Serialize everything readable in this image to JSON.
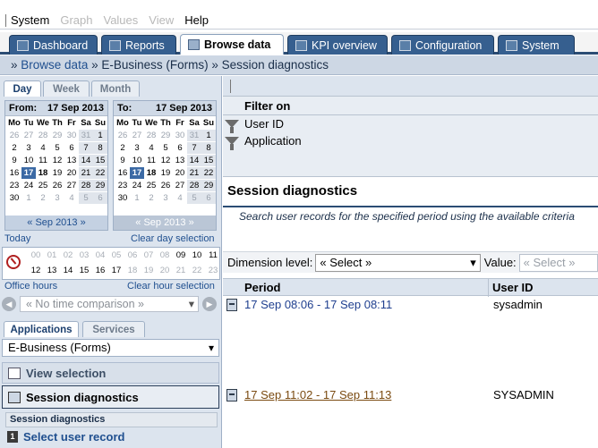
{
  "menu": {
    "items": [
      {
        "label": "System",
        "enabled": true
      },
      {
        "label": "Graph",
        "enabled": false
      },
      {
        "label": "Values",
        "enabled": false
      },
      {
        "label": "View",
        "enabled": false
      },
      {
        "label": "Help",
        "enabled": true
      }
    ]
  },
  "tabs": [
    {
      "label": "Dashboard",
      "icon": "dashboard-icon",
      "active": false
    },
    {
      "label": "Reports",
      "icon": "reports-icon",
      "active": false
    },
    {
      "label": "Browse data",
      "icon": "cube-icon",
      "active": true
    },
    {
      "label": "KPI overview",
      "icon": "gauge-icon",
      "active": false
    },
    {
      "label": "Configuration",
      "icon": "gear-icon",
      "active": false
    },
    {
      "label": "System",
      "icon": "monitor-icon",
      "active": false
    }
  ],
  "breadcrumb": {
    "prefix": "»",
    "link": "Browse data",
    "rest": "» E-Business (Forms) » Session diagnostics"
  },
  "period_tabs": [
    "Day",
    "Week",
    "Month"
  ],
  "calendar_from": {
    "label": "From:",
    "date": "17 Sep 2013",
    "month": "« Sep 2013 »"
  },
  "calendar_to": {
    "label": "To:",
    "date": "17 Sep 2013",
    "month": "« Sep 2013 »"
  },
  "dow": [
    "Mo",
    "Tu",
    "We",
    "Th",
    "Fr",
    "Sa",
    "Su"
  ],
  "days": [
    "26",
    "27",
    "28",
    "29",
    "30",
    "31",
    "1",
    "2",
    "3",
    "4",
    "5",
    "6",
    "7",
    "8",
    "9",
    "10",
    "11",
    "12",
    "13",
    "14",
    "15",
    "16",
    "17",
    "18",
    "19",
    "20",
    "21",
    "22",
    "23",
    "24",
    "25",
    "26",
    "27",
    "28",
    "29",
    "30",
    "1",
    "2",
    "3",
    "4",
    "5",
    "6"
  ],
  "today_link": "Today",
  "clear_day": "Clear day selection",
  "hours_row1": [
    "00",
    "01",
    "02",
    "03",
    "04",
    "05",
    "06",
    "07",
    "08",
    "09",
    "10",
    "11"
  ],
  "hours_row2": [
    "12",
    "13",
    "14",
    "15",
    "16",
    "17",
    "18",
    "19",
    "20",
    "21",
    "22",
    "23"
  ],
  "office_hours": "Office hours",
  "clear_hour": "Clear hour selection",
  "time_comparison": "« No time comparison »",
  "left_tabs": [
    "Applications",
    "Services"
  ],
  "application_select": "E-Business (Forms)",
  "view_selection": "View selection",
  "session_diagnostics": "Session diagnostics",
  "section_label": "Session diagnostics",
  "select_user_record": "Select user record",
  "select_user_record_num": "1",
  "filter": {
    "header": "Filter on",
    "items": [
      "User ID",
      "Application"
    ]
  },
  "title": "Session diagnostics",
  "description": "Search user records for the specified period using the available criteria",
  "dimension": {
    "label": "Dimension level:",
    "value": "« Select »",
    "value_label": "Value:",
    "value_placeholder": "« Select »"
  },
  "table": {
    "columns": [
      "Period",
      "User ID"
    ],
    "rows": [
      {
        "period": "17 Sep 08:06 - 17 Sep 08:11",
        "user": "sysadmin",
        "visited": false
      },
      {
        "period": "17 Sep 11:02 - 17 Sep 11:13",
        "user": "SYSADMIN",
        "visited": true
      }
    ]
  },
  "colors": {
    "accent": "#365f8f",
    "link": "#1f4f8f",
    "panel": "#dce4ee",
    "visited_link": "#7a4a10"
  }
}
